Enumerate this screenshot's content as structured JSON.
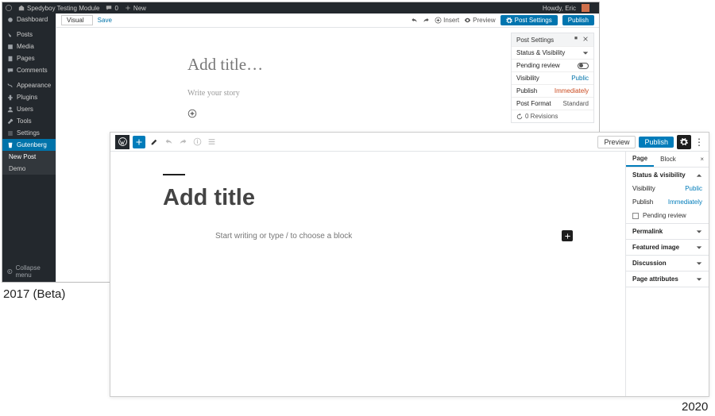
{
  "captions": {
    "beta": "2017 (Beta)",
    "current": "2020"
  },
  "wp2017": {
    "adminbar": {
      "site_name": "Spedyboy Testing Module",
      "comments": "0",
      "new": "New",
      "howdy": "Howdy, Eric"
    },
    "sidebar": {
      "items": [
        "Dashboard",
        "Posts",
        "Media",
        "Pages",
        "Comments",
        "Appearance",
        "Plugins",
        "Users",
        "Tools",
        "Settings"
      ],
      "active": "Gutenberg",
      "sub": [
        "New Post",
        "Demo"
      ],
      "collapse": "Collapse menu"
    },
    "toolbar": {
      "visual": "Visual",
      "save": "Save",
      "insert": "Insert",
      "preview": "Preview",
      "post_settings": "Post Settings",
      "publish": "Publish"
    },
    "editor": {
      "title_placeholder": "Add title…",
      "story_placeholder": "Write your story"
    },
    "panel": {
      "header": "Post Settings",
      "status": "Status & Visibility",
      "pending": "Pending review",
      "visibility_k": "Visibility",
      "visibility_v": "Public",
      "publish_k": "Publish",
      "publish_v": "Immediately",
      "format_k": "Post Format",
      "format_v": "Standard",
      "revisions": "0 Revisions"
    }
  },
  "wp2020": {
    "toolbar": {
      "preview": "Preview",
      "publish": "Publish"
    },
    "editor": {
      "title_placeholder": "Add title",
      "prompt": "Start writing or type / to choose a block"
    },
    "panel": {
      "tabs": [
        "Page",
        "Block"
      ],
      "status": "Status & visibility",
      "visibility_k": "Visibility",
      "visibility_v": "Public",
      "publish_k": "Publish",
      "publish_v": "Immediately",
      "pending": "Pending review",
      "sections": [
        "Permalink",
        "Featured image",
        "Discussion",
        "Page attributes"
      ]
    }
  }
}
